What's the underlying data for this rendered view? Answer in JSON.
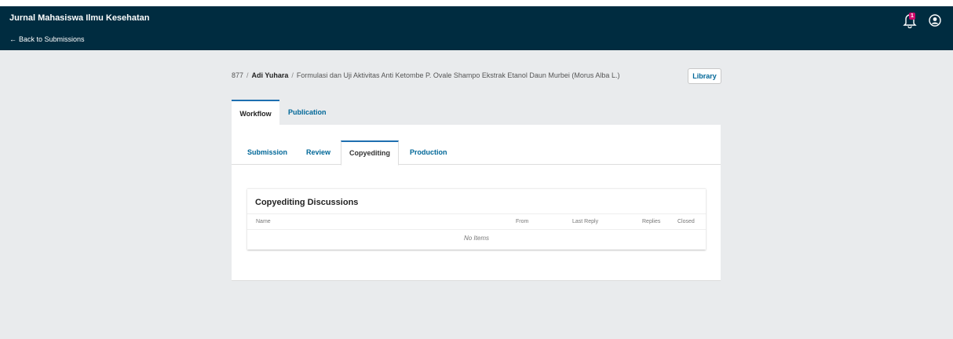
{
  "header": {
    "journal_title": "Jurnal Mahasiswa Ilmu Kesehatan",
    "back_link": "Back to Submissions",
    "notification_count": "1",
    "colors": {
      "header_bg": "#002c40",
      "link": "#006798",
      "badge": "#d00a6c",
      "tab_accent": "#1e6fb0"
    }
  },
  "breadcrumb": {
    "id": "877",
    "author": "Adi Yuhara",
    "title": "Formulasi dan Uji Aktivitas Anti Ketombe P. Ovale Shampo Ekstrak Etanol Daun Murbei (Morus Alba L.)"
  },
  "library_button": "Library",
  "outer_tabs": [
    {
      "label": "Workflow",
      "active": true
    },
    {
      "label": "Publication",
      "active": false
    }
  ],
  "inner_tabs": [
    {
      "label": "Submission",
      "active": false
    },
    {
      "label": "Review",
      "active": false
    },
    {
      "label": "Copyediting",
      "active": true
    },
    {
      "label": "Production",
      "active": false
    }
  ],
  "discussions": {
    "title": "Copyediting Discussions",
    "columns": [
      "Name",
      "From",
      "Last Reply",
      "Replies",
      "Closed"
    ],
    "empty_text": "No Items"
  }
}
